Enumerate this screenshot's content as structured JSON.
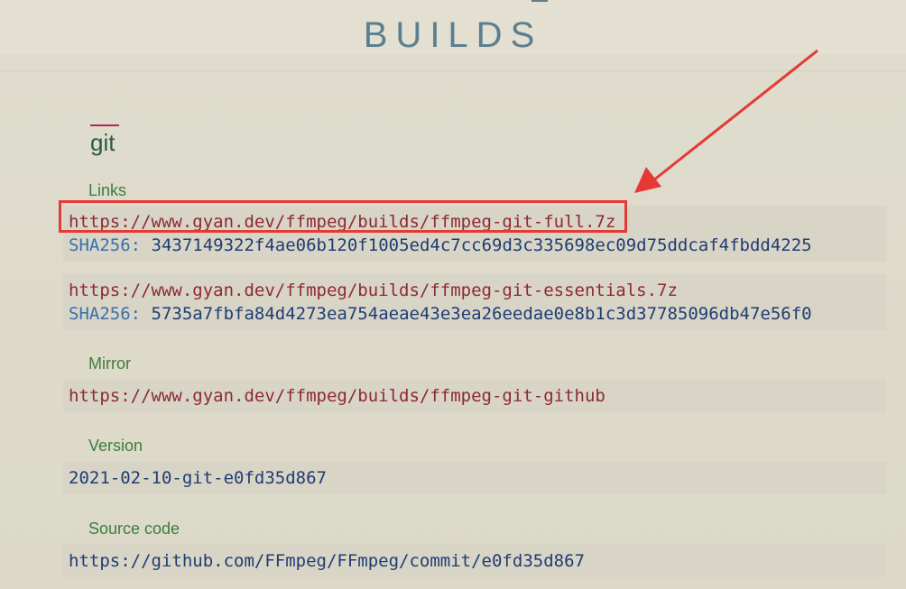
{
  "header": {
    "title": "BUILDS"
  },
  "section": {
    "title": "git"
  },
  "links": {
    "label": "Links",
    "items": [
      {
        "url": "https://www.gyan.dev/ffmpeg/builds/ffmpeg-git-full.7z",
        "hash_label": "SHA256:",
        "hash_value": "3437149322f4ae06b120f1005ed4c7cc69d3c335698ec09d75ddcaf4fbdd4225"
      },
      {
        "url": "https://www.gyan.dev/ffmpeg/builds/ffmpeg-git-essentials.7z",
        "hash_label": "SHA256:",
        "hash_value": "5735a7fbfa84d4273ea754aeae43e3ea26eedae0e8b1c3d37785096db47e56f0"
      }
    ]
  },
  "mirror": {
    "label": "Mirror",
    "url": "https://www.gyan.dev/ffmpeg/builds/ffmpeg-git-github"
  },
  "version": {
    "label": "Version",
    "value": "2021-02-10-git-e0fd35d867"
  },
  "source": {
    "label": "Source code",
    "url": "https://github.com/FFmpeg/FFmpeg/commit/e0fd35d867"
  },
  "annotation": {
    "color": "#e53935"
  },
  "colors": {
    "title": "#5b7f8e",
    "section_title": "#2a5a48",
    "label": "#3f7c3f",
    "url": "#8d2a33",
    "hash_key": "#3771ac",
    "code_bg": "#d8d4c6",
    "background": "#e3dfd1"
  }
}
